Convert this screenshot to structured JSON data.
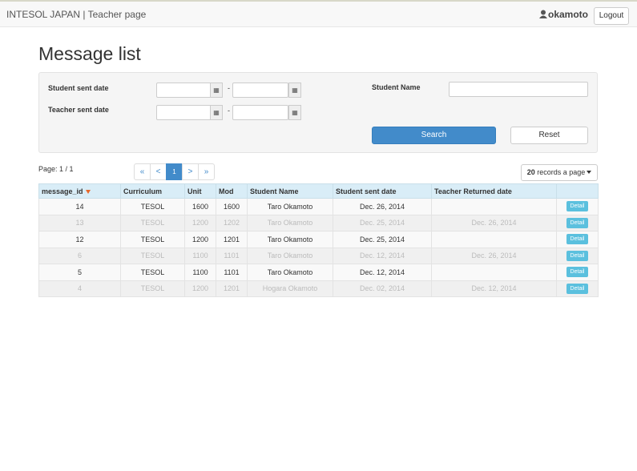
{
  "header": {
    "brand": "INTESOL JAPAN | Teacher page",
    "username": "okamoto",
    "logout_label": "Logout"
  },
  "page_title": "Message list",
  "search": {
    "student_sent_label": "Student sent date",
    "teacher_sent_label": "Teacher sent date",
    "student_name_label": "Student Name",
    "range_separator": "-",
    "search_label": "Search",
    "reset_label": "Reset"
  },
  "pagination": {
    "page_info": "Page: 1 / 1",
    "first": "«",
    "prev": "<",
    "current": "1",
    "next": ">",
    "last": "»",
    "records_count": "20",
    "records_suffix": "records a page"
  },
  "table": {
    "columns": [
      "message_id",
      "Curriculum",
      "Unit",
      "Mod",
      "Student Name",
      "Student sent date",
      "Teacher Returned date",
      ""
    ],
    "rows": [
      {
        "id": "14",
        "curriculum": "TESOL",
        "unit": "1600",
        "mod": "1600",
        "student": "Taro Okamoto",
        "sent": "Dec. 26, 2014",
        "returned": "",
        "action": "Detail"
      },
      {
        "id": "13",
        "curriculum": "TESOL",
        "unit": "1200",
        "mod": "1202",
        "student": "Taro Okamoto",
        "sent": "Dec. 25, 2014",
        "returned": "Dec. 26, 2014",
        "action": "Detail"
      },
      {
        "id": "12",
        "curriculum": "TESOL",
        "unit": "1200",
        "mod": "1201",
        "student": "Taro Okamoto",
        "sent": "Dec. 25, 2014",
        "returned": "",
        "action": "Detail"
      },
      {
        "id": "6",
        "curriculum": "TESOL",
        "unit": "1100",
        "mod": "1101",
        "student": "Taro Okamoto",
        "sent": "Dec. 12, 2014",
        "returned": "Dec. 26, 2014",
        "action": "Detail"
      },
      {
        "id": "5",
        "curriculum": "TESOL",
        "unit": "1100",
        "mod": "1101",
        "student": "Taro Okamoto",
        "sent": "Dec. 12, 2014",
        "returned": "",
        "action": "Detail"
      },
      {
        "id": "4",
        "curriculum": "TESOL",
        "unit": "1200",
        "mod": "1201",
        "student": "Hogara Okamoto",
        "sent": "Dec. 02, 2014",
        "returned": "Dec. 12, 2014",
        "action": "Detail"
      }
    ]
  },
  "colors": {
    "primary": "#428bca",
    "info": "#5bc0de",
    "header_bg": "#d9edf7",
    "sort_arrow": "#e8682a"
  },
  "icons": {
    "user": "user-icon",
    "calendar": "calendar-icon",
    "sort": "sort-desc-icon",
    "caret": "caret-down-icon"
  }
}
